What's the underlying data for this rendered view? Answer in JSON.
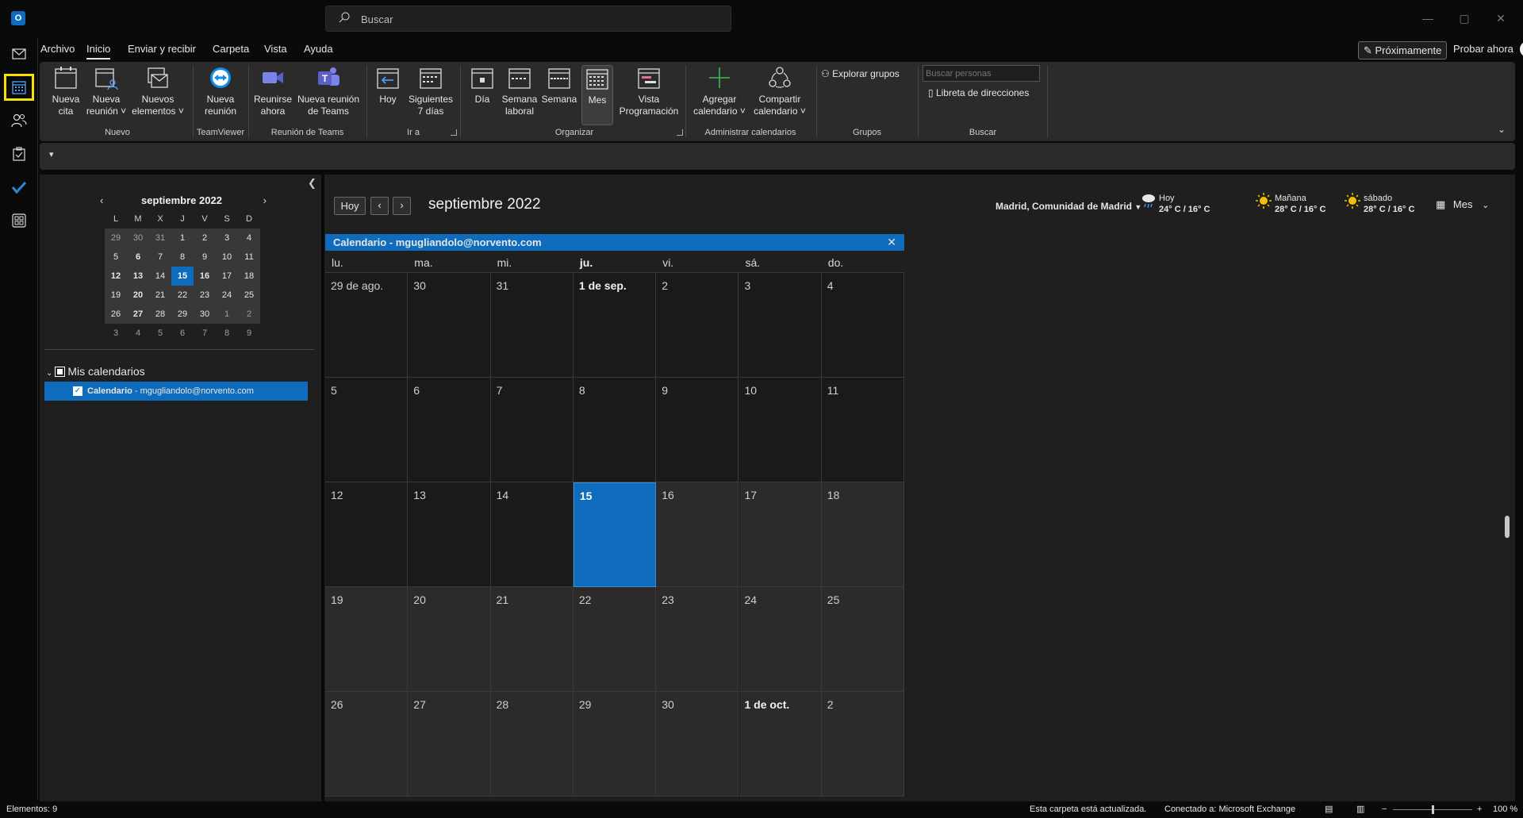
{
  "search": {
    "placeholder": "Buscar"
  },
  "window": {
    "minimize": "—",
    "maximize": "▢",
    "close": "✕"
  },
  "menu": {
    "tabs": [
      "Archivo",
      "Inicio",
      "Enviar y recibir",
      "Carpeta",
      "Vista",
      "Ayuda"
    ],
    "proximamente": "Próximamente",
    "probar": "Probar ahora"
  },
  "ribbon": {
    "nueva_cita": [
      "Nueva",
      "cita"
    ],
    "nueva_reunion": [
      "Nueva",
      "reunión ˅"
    ],
    "nuevos_elementos": [
      "Nuevos",
      "elementos ˅"
    ],
    "tv_reunion": [
      "Nueva",
      "reunión"
    ],
    "reunirse": [
      "Reunirse",
      "ahora"
    ],
    "reunion_teams": [
      "Nueva reunión",
      "de Teams"
    ],
    "hoy": "Hoy",
    "siguientes": [
      "Siguientes",
      "7 días"
    ],
    "dia": "Día",
    "semana_laboral": [
      "Semana",
      "laboral"
    ],
    "semana": "Semana",
    "mes": "Mes",
    "vista_prog": [
      "Vista",
      "Programación"
    ],
    "agregar": [
      "Agregar",
      "calendario ˅"
    ],
    "compartir": [
      "Compartir",
      "calendario ˅"
    ],
    "explorar": "Explorar grupos",
    "buscar_personas": "Buscar personas",
    "libreta": "Libreta de direcciones",
    "groups": [
      "Nuevo",
      "TeamViewer",
      "Reunión de Teams",
      "Ir a",
      "Organizar",
      "Administrar calendarios",
      "Grupos",
      "Buscar"
    ]
  },
  "mini_calendar": {
    "title": "septiembre 2022",
    "weekdays": [
      "L",
      "M",
      "X",
      "J",
      "V",
      "S",
      "D"
    ],
    "weeks": [
      [
        "29",
        "30",
        "31",
        "1",
        "2",
        "3",
        "4"
      ],
      [
        "5",
        "6",
        "7",
        "8",
        "9",
        "10",
        "11"
      ],
      [
        "12",
        "13",
        "14",
        "15",
        "16",
        "17",
        "18"
      ],
      [
        "19",
        "20",
        "21",
        "22",
        "23",
        "24",
        "25"
      ],
      [
        "26",
        "27",
        "28",
        "29",
        "30",
        "1",
        "2"
      ],
      [
        "3",
        "4",
        "5",
        "6",
        "7",
        "8",
        "9"
      ]
    ],
    "today": "15"
  },
  "folders": {
    "group": "Mis calendarios",
    "calendar_bold": "Calendario",
    "calendar_rest": " - mgugliandolo@norvento.com"
  },
  "calendar": {
    "today_button": "Hoy",
    "title": "septiembre 2022",
    "location": "Madrid, Comunidad de Madrid",
    "weather": [
      {
        "day": "Hoy",
        "temps": "24° C / 16° C",
        "icon": "rain-cloud-icon"
      },
      {
        "day": "Mañana",
        "temps": "28° C / 16° C",
        "icon": "sun-icon"
      },
      {
        "day": "sábado",
        "temps": "28° C / 16° C",
        "icon": "sun-icon"
      }
    ],
    "view_selector": "Mes",
    "banner": "Calendario - mgugliandolo@norvento.com",
    "weekdays": [
      "lu.",
      "ma.",
      "mi.",
      "ju.",
      "vi.",
      "sá.",
      "do."
    ],
    "weeks": [
      [
        "29 de ago.",
        "30",
        "31",
        "1 de sep.",
        "2",
        "3",
        "4"
      ],
      [
        "5",
        "6",
        "7",
        "8",
        "9",
        "10",
        "11"
      ],
      [
        "12",
        "13",
        "14",
        "15",
        "16",
        "17",
        "18"
      ],
      [
        "19",
        "20",
        "21",
        "22",
        "23",
        "24",
        "25"
      ],
      [
        "26",
        "27",
        "28",
        "29",
        "30",
        "1 de oct.",
        "2"
      ]
    ]
  },
  "status": {
    "elementos": "Elementos: 9",
    "actualizada": "Esta carpeta está actualizada.",
    "conectado": "Conectado a: Microsoft Exchange",
    "zoom": "100 %"
  },
  "colors": {
    "accent": "#0f6cbd",
    "highlight": "#f2e300"
  }
}
